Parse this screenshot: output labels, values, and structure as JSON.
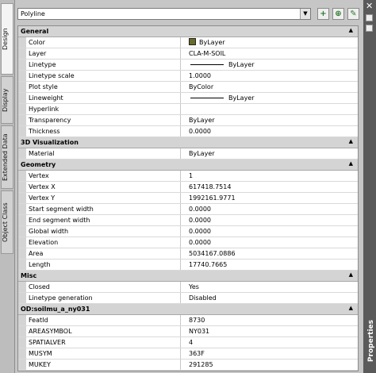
{
  "side_tabs": [
    "Design",
    "Display",
    "Extended Data",
    "Object Class"
  ],
  "right_panel": {
    "close_glyph": "✕",
    "label": "Properties"
  },
  "selector": {
    "value": "Polyline",
    "arrow": "▼"
  },
  "toolbar": {
    "btn1": "+",
    "btn2": "⊕",
    "btn3": "✎"
  },
  "sections": {
    "general": {
      "title": "General",
      "caret": "▲",
      "rows": [
        {
          "name": "Color",
          "value": "ByLayer"
        },
        {
          "name": "Layer",
          "value": "CLA-M-SOIL"
        },
        {
          "name": "Linetype",
          "value": "ByLayer"
        },
        {
          "name": "Linetype scale",
          "value": "1.0000"
        },
        {
          "name": "Plot style",
          "value": "ByColor"
        },
        {
          "name": "Lineweight",
          "value": "ByLayer"
        },
        {
          "name": "Hyperlink",
          "value": ""
        },
        {
          "name": "Transparency",
          "value": "ByLayer"
        },
        {
          "name": "Thickness",
          "value": "0.0000"
        }
      ]
    },
    "viz": {
      "title": "3D Visualization",
      "caret": "▲",
      "rows": [
        {
          "name": "Material",
          "value": "ByLayer"
        }
      ]
    },
    "geometry": {
      "title": "Geometry",
      "caret": "▲",
      "rows": [
        {
          "name": "Vertex",
          "value": "1"
        },
        {
          "name": "Vertex X",
          "value": "617418.7514"
        },
        {
          "name": "Vertex Y",
          "value": "1992161.9771"
        },
        {
          "name": "Start segment width",
          "value": "0.0000"
        },
        {
          "name": "End segment width",
          "value": "0.0000"
        },
        {
          "name": "Global width",
          "value": "0.0000"
        },
        {
          "name": "Elevation",
          "value": "0.0000"
        },
        {
          "name": "Area",
          "value": "5034167.0886"
        },
        {
          "name": "Length",
          "value": "17740.7665"
        }
      ]
    },
    "misc": {
      "title": "Misc",
      "caret": "▲",
      "rows": [
        {
          "name": "Closed",
          "value": "Yes"
        },
        {
          "name": "Linetype generation",
          "value": "Disabled"
        }
      ]
    },
    "od": {
      "title": "OD:soilmu_a_ny031",
      "caret": "▲",
      "rows": [
        {
          "name": "FeatId",
          "value": "8730"
        },
        {
          "name": "AREASYMBOL",
          "value": "NY031"
        },
        {
          "name": "SPATIALVER",
          "value": "4"
        },
        {
          "name": "MUSYM",
          "value": "363F"
        },
        {
          "name": "MUKEY",
          "value": "291285"
        }
      ]
    }
  }
}
